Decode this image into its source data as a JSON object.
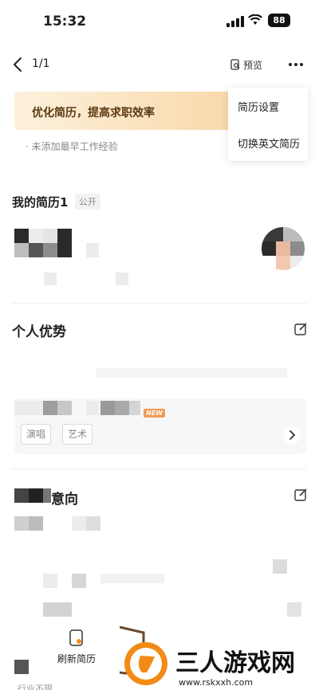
{
  "status_bar": {
    "time": "15:32",
    "battery": "88"
  },
  "nav": {
    "page_indicator": "1/1",
    "preview_label": "预览"
  },
  "banner": {
    "text": "优化简历，提高求职效率"
  },
  "note": {
    "text": "· 未添加最早工作经验"
  },
  "menu": {
    "items": [
      "简历设置",
      "切换英文简历"
    ]
  },
  "resume": {
    "title": "我的简历1",
    "visibility": "公开"
  },
  "sections": {
    "advantage": {
      "title": "个人优势"
    },
    "intent": {
      "title": "意向"
    }
  },
  "skills": {
    "new_badge": "NEW",
    "tags": [
      "演唱",
      "艺术"
    ]
  },
  "bottom": {
    "refresh_label": "刷新简历",
    "industry_text": "行业不限"
  },
  "watermark": {
    "brand": "三人游戏网",
    "url": "www.rskxxh.com"
  },
  "colors": {
    "banner_start": "#fdf1dc",
    "banner_end": "#f9d9ab",
    "new_badge": "#f39a52",
    "brand_orange": "#f28b16"
  }
}
